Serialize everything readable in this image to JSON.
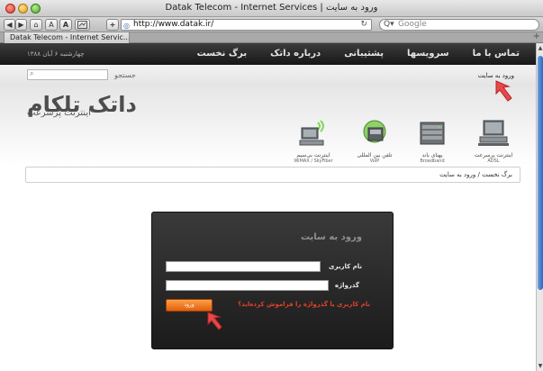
{
  "browser": {
    "title": "Datak Telecom - Internet Services | ورود به سایت",
    "address": "http://www.datak.ir/",
    "search_placeholder": "Google",
    "tab_label": "Datak Telecom - Internet Servic...",
    "buttons": {
      "back": "◀",
      "forward": "▶",
      "home": "⌂",
      "text_smaller": "A",
      "text_bigger": "A",
      "add": "+"
    }
  },
  "site": {
    "nav": [
      "برگ نخست",
      "درباره داتک",
      "پشتیبانی",
      "سرویسها",
      "تماس با ما"
    ],
    "date": "چهارشنبه ۶ آبان ۱۳۸۸",
    "search_label": "جستجو",
    "login_link": "ورود به سایت",
    "logo": {
      "main": "داتک تلکام",
      "sub": "اینترنت پرسرعت"
    },
    "services": [
      {
        "title": "اینترنت پرسرعت",
        "sub": "ADSL"
      },
      {
        "title": "پهنای باند",
        "sub": "Broadband"
      },
      {
        "title": "تلفن بین المللی",
        "sub": "VoIP"
      },
      {
        "title": "اینترنت بی‌سیم",
        "sub": "WiMAX / SkyFiber"
      }
    ],
    "breadcrumb": "برگ نخست / ورود به سایت"
  },
  "login": {
    "title": "ورود به سایت",
    "username_label": "نام کاربری",
    "password_label": "گذرواژه",
    "username_value": "",
    "password_value": "",
    "submit_label": "ورود",
    "forgot_label": "نام کاربری یا گذرواژه را فراموش کرده‌اید؟"
  },
  "colors": {
    "accent": "#e25f0a",
    "arrow": "#e8484a",
    "nav_bg": "#1e1e1e",
    "forgot": "#e0402c"
  }
}
